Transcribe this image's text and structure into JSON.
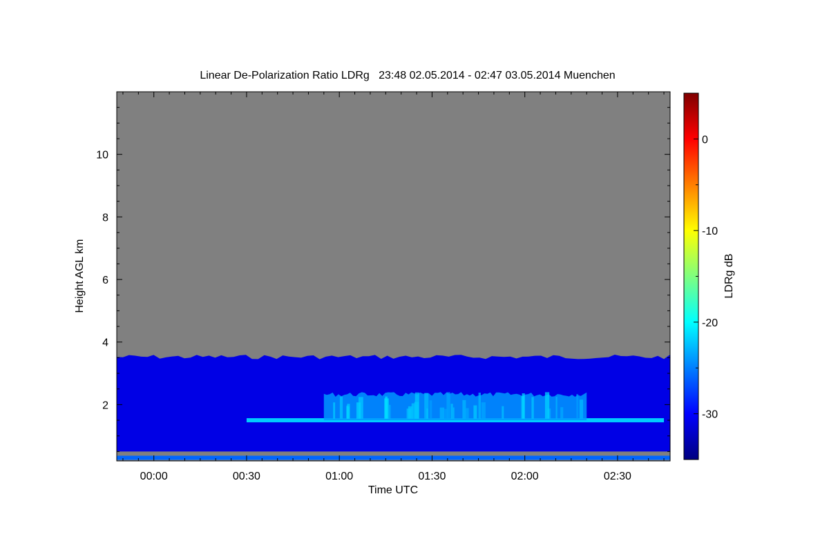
{
  "chart_data": {
    "type": "heatmap",
    "title": "Linear De-Polarization Ratio LDRg   23:48 02.05.2014 - 02:47 03.05.2014 Muenchen",
    "xlabel": "Time UTC",
    "ylabel": "Height AGL km",
    "x_range_minutes": [
      -12,
      167
    ],
    "y_range_km": [
      0.2,
      12.0
    ],
    "x_ticks": [
      {
        "minutes": 0,
        "label": "00:00"
      },
      {
        "minutes": 30,
        "label": "00:30"
      },
      {
        "minutes": 60,
        "label": "01:00"
      },
      {
        "minutes": 90,
        "label": "01:30"
      },
      {
        "minutes": 120,
        "label": "02:00"
      },
      {
        "minutes": 150,
        "label": "02:30"
      }
    ],
    "y_ticks": [
      {
        "value": 2,
        "label": "2"
      },
      {
        "value": 4,
        "label": "4"
      },
      {
        "value": 6,
        "label": "6"
      },
      {
        "value": 8,
        "label": "8"
      },
      {
        "value": 10,
        "label": "10"
      }
    ],
    "no_data_color": "#808080",
    "colorbar": {
      "label": "LDRg dB",
      "range": [
        -35,
        5
      ],
      "ticks": [
        {
          "value": 0,
          "label": "0"
        },
        {
          "value": -10,
          "label": "-10"
        },
        {
          "value": -20,
          "label": "-20"
        },
        {
          "value": -30,
          "label": "-30"
        }
      ],
      "colormap": [
        "#00007f",
        "#0000ff",
        "#007fff",
        "#00ffff",
        "#7fff7f",
        "#ffff00",
        "#ff7f00",
        "#ff0000",
        "#7f0000"
      ]
    },
    "features": [
      {
        "name": "aerosol layer",
        "x_range_minutes": [
          -12,
          167
        ],
        "height_range_km": [
          0.5,
          3.6
        ],
        "ldr_db": -31
      },
      {
        "name": "enhanced depolarization layer",
        "x_range_minutes": [
          30,
          165
        ],
        "height_km": 1.5,
        "ldr_db": -22
      },
      {
        "name": "depolarizing plumes",
        "x_range_minutes": [
          55,
          140
        ],
        "height_range_km": [
          1.5,
          2.4
        ],
        "ldr_db": -24
      },
      {
        "name": "near-ground layer",
        "x_range_minutes": [
          -12,
          167
        ],
        "height_km": 0.3,
        "ldr_db": -26
      }
    ]
  }
}
